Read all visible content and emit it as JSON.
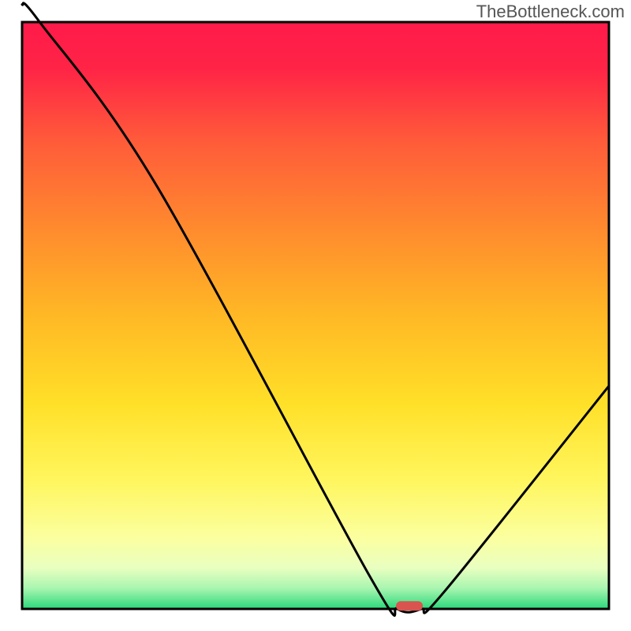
{
  "watermark": "TheBottleneck.com",
  "chart_data": {
    "type": "line",
    "title": "",
    "xlabel": "",
    "ylabel": "",
    "xlim": [
      0,
      100
    ],
    "ylim": [
      0,
      100
    ],
    "x": [
      0,
      3,
      23,
      59,
      64,
      68,
      72,
      100
    ],
    "values": [
      103,
      100,
      72,
      6,
      0,
      0,
      3,
      38
    ],
    "marker": {
      "x": 66,
      "y": 0.5,
      "color": "#d9534f"
    },
    "background": {
      "type": "vertical-gradient",
      "stops": [
        {
          "pos": 0.0,
          "color": "#ff1a4a"
        },
        {
          "pos": 0.08,
          "color": "#ff2446"
        },
        {
          "pos": 0.2,
          "color": "#ff5a3a"
        },
        {
          "pos": 0.35,
          "color": "#ff8a2e"
        },
        {
          "pos": 0.5,
          "color": "#ffb825"
        },
        {
          "pos": 0.65,
          "color": "#ffe028"
        },
        {
          "pos": 0.78,
          "color": "#fff65e"
        },
        {
          "pos": 0.88,
          "color": "#fbffa0"
        },
        {
          "pos": 0.93,
          "color": "#e9ffc0"
        },
        {
          "pos": 0.965,
          "color": "#a8f5b0"
        },
        {
          "pos": 1.0,
          "color": "#2bd87a"
        }
      ]
    }
  }
}
